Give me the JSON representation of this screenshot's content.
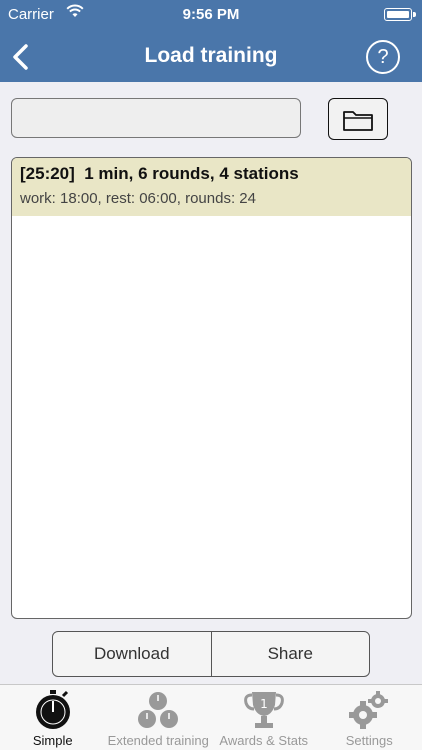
{
  "status": {
    "carrier": "Carrier",
    "time": "9:56 PM"
  },
  "nav": {
    "title": "Load training",
    "help": "?"
  },
  "search": {
    "value": "",
    "placeholder": ""
  },
  "list": {
    "items": [
      {
        "title": "[25:20]  1 min, 6 rounds, 4 stations",
        "detail": "work: 18:00, rest: 06:00, rounds: 24"
      }
    ]
  },
  "actions": {
    "download": "Download",
    "share": "Share"
  },
  "tabs": [
    {
      "label": "Simple",
      "icon": "stopwatch-icon",
      "active": true
    },
    {
      "label": "Extended training",
      "icon": "multi-stopwatch-icon",
      "active": false
    },
    {
      "label": "Awards & Stats",
      "icon": "trophy-icon",
      "active": false
    },
    {
      "label": "Settings",
      "icon": "gears-icon",
      "active": false
    }
  ],
  "colors": {
    "nav": "#4a76aa",
    "selected_row": "#e9e6c6",
    "tab_inactive": "#999999"
  }
}
